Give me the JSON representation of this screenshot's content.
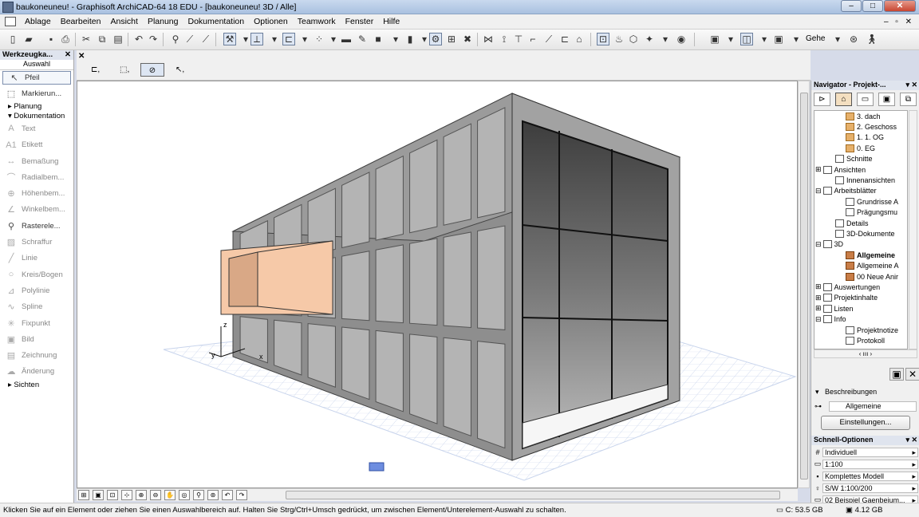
{
  "window": {
    "title": "baukoneuneu! - Graphisoft ArchiCAD-64 18 EDU - [baukoneuneu! 3D / Alle]",
    "min": "–",
    "max": "□",
    "close": "✕"
  },
  "menu": [
    "Ablage",
    "Bearbeiten",
    "Ansicht",
    "Planung",
    "Dokumentation",
    "Optionen",
    "Teamwork",
    "Fenster",
    "Hilfe"
  ],
  "menu_mdi": "– ▫ ✕",
  "toolbar": {
    "gehe_label": "Gehe"
  },
  "toolbox": {
    "title": "Werkzeugka...",
    "close": "✕",
    "auswahl": "Auswahl",
    "pfeil": "Pfeil",
    "markierung": "Markierun...",
    "planung": "Planung",
    "dokumentation": "Dokumentation",
    "tools": [
      {
        "label": "Text",
        "icon": "A",
        "dim": true
      },
      {
        "label": "Etikett",
        "icon": "A1",
        "dim": true
      },
      {
        "label": "Bemaßung",
        "icon": "↔",
        "dim": true
      },
      {
        "label": "Radialbem...",
        "icon": "⌒",
        "dim": true
      },
      {
        "label": "Höhenbem...",
        "icon": "⊕",
        "dim": true
      },
      {
        "label": "Winkelbem...",
        "icon": "∠",
        "dim": true
      },
      {
        "label": "Rasterele...",
        "icon": "⚲",
        "dim": false
      },
      {
        "label": "Schraffur",
        "icon": "▨",
        "dim": true
      },
      {
        "label": "Linie",
        "icon": "╱",
        "dim": true
      },
      {
        "label": "Kreis/Bogen",
        "icon": "○",
        "dim": true
      },
      {
        "label": "Polylinie",
        "icon": "⊿",
        "dim": true
      },
      {
        "label": "Spline",
        "icon": "∿",
        "dim": true
      },
      {
        "label": "Fixpunkt",
        "icon": "✳",
        "dim": true
      },
      {
        "label": "Bild",
        "icon": "▣",
        "dim": true
      },
      {
        "label": "Zeichnung",
        "icon": "▤",
        "dim": true
      },
      {
        "label": "Änderung",
        "icon": "☁",
        "dim": true
      }
    ],
    "sichten": "Sichten"
  },
  "infobox": {
    "close": "✕"
  },
  "viewport": {
    "axis_z": "z",
    "axis_y": "y",
    "axis_x": "x"
  },
  "navigator": {
    "title": "Navigator - Projekt-...",
    "close": "▾ ✕",
    "tree": [
      {
        "label": "3. dach",
        "indent": 3,
        "icon": "fold"
      },
      {
        "label": "2. Geschoss",
        "indent": 3,
        "icon": "fold"
      },
      {
        "label": "1. 1. OG",
        "indent": 3,
        "icon": "fold"
      },
      {
        "label": "0. EG",
        "indent": 3,
        "icon": "fold"
      },
      {
        "label": "Schnitte",
        "indent": 2,
        "icon": "plain"
      },
      {
        "label": "Ansichten",
        "indent": 1,
        "icon": "plain",
        "toggle": "⊞"
      },
      {
        "label": "Innenansichten",
        "indent": 2,
        "icon": "plain"
      },
      {
        "label": "Arbeitsblätter",
        "indent": 1,
        "icon": "plain",
        "toggle": "⊟"
      },
      {
        "label": "Grundrisse A",
        "indent": 3,
        "icon": "plain"
      },
      {
        "label": "Prägungsmu",
        "indent": 3,
        "icon": "plain"
      },
      {
        "label": "Details",
        "indent": 2,
        "icon": "plain"
      },
      {
        "label": "3D-Dokumente",
        "indent": 2,
        "icon": "plain"
      },
      {
        "label": "3D",
        "indent": 1,
        "icon": "plain",
        "toggle": "⊟"
      },
      {
        "label": "Allgemeine",
        "indent": 3,
        "icon": "cam",
        "selected": true
      },
      {
        "label": "Allgemeine A",
        "indent": 3,
        "icon": "cam"
      },
      {
        "label": "00 Neue Anir",
        "indent": 3,
        "icon": "cam"
      },
      {
        "label": "Auswertungen",
        "indent": 1,
        "icon": "plain",
        "toggle": "⊞"
      },
      {
        "label": "Projektinhalte",
        "indent": 1,
        "icon": "plain",
        "toggle": "⊞"
      },
      {
        "label": "Listen",
        "indent": 1,
        "icon": "plain",
        "toggle": "⊞"
      },
      {
        "label": "Info",
        "indent": 1,
        "icon": "plain",
        "toggle": "⊟"
      },
      {
        "label": "Projektnotize",
        "indent": 3,
        "icon": "plain"
      },
      {
        "label": "Protokoll",
        "indent": 3,
        "icon": "plain"
      }
    ],
    "tree_hscroll": "‹   ııı   ›",
    "beschreibungen": "Beschreibungen",
    "field_value": "Allgemeine",
    "einstellungen": "Einstellungen..."
  },
  "schnell": {
    "title": "Schnell-Optionen",
    "close": "▾ ✕",
    "options": [
      {
        "icon": "#",
        "value": "Individuell"
      },
      {
        "icon": "▭",
        "value": "1:100"
      },
      {
        "icon": "▪",
        "value": "Komplettes Modell"
      },
      {
        "icon": "♀",
        "value": "S/W 1:100/200"
      },
      {
        "icon": "▭",
        "value": "02 Beispiel Gaenbeium..."
      }
    ]
  },
  "status": {
    "message": "Klicken Sie auf ein Element oder ziehen Sie einen Auswahlbereich auf. Halten Sie Strg/Ctrl+Umsch gedrückt, um zwischen Element/Unterelement-Auswahl zu schalten.",
    "disk": "C: 53.5 GB",
    "ram": "4.12 GB"
  },
  "colors": {
    "wall": "#8e8e8e",
    "wall_front": "#a2a2a2",
    "panel": "#b4b4b4",
    "box": "#f6c9a8",
    "grid": "#c8d4ec"
  }
}
